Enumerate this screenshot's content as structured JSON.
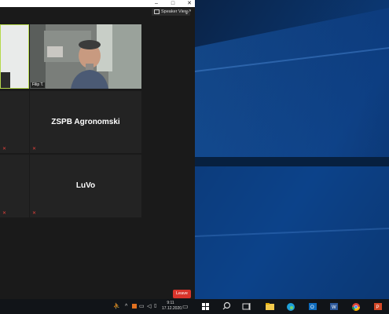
{
  "zoom": {
    "speaker_view_label": "Speaker View",
    "participants": [
      {
        "name": "ZSPB Agronomski"
      },
      {
        "name": "LuVo"
      }
    ],
    "video_tag": "Filip T.",
    "leave_label": "Leave"
  },
  "taskbar": {
    "time": "9:11",
    "date": "17.12.2020."
  },
  "colors": {
    "leave": "#d9342b",
    "active_speaker_border": "#b6d94c",
    "desktop_bg": "#0b2c56"
  }
}
